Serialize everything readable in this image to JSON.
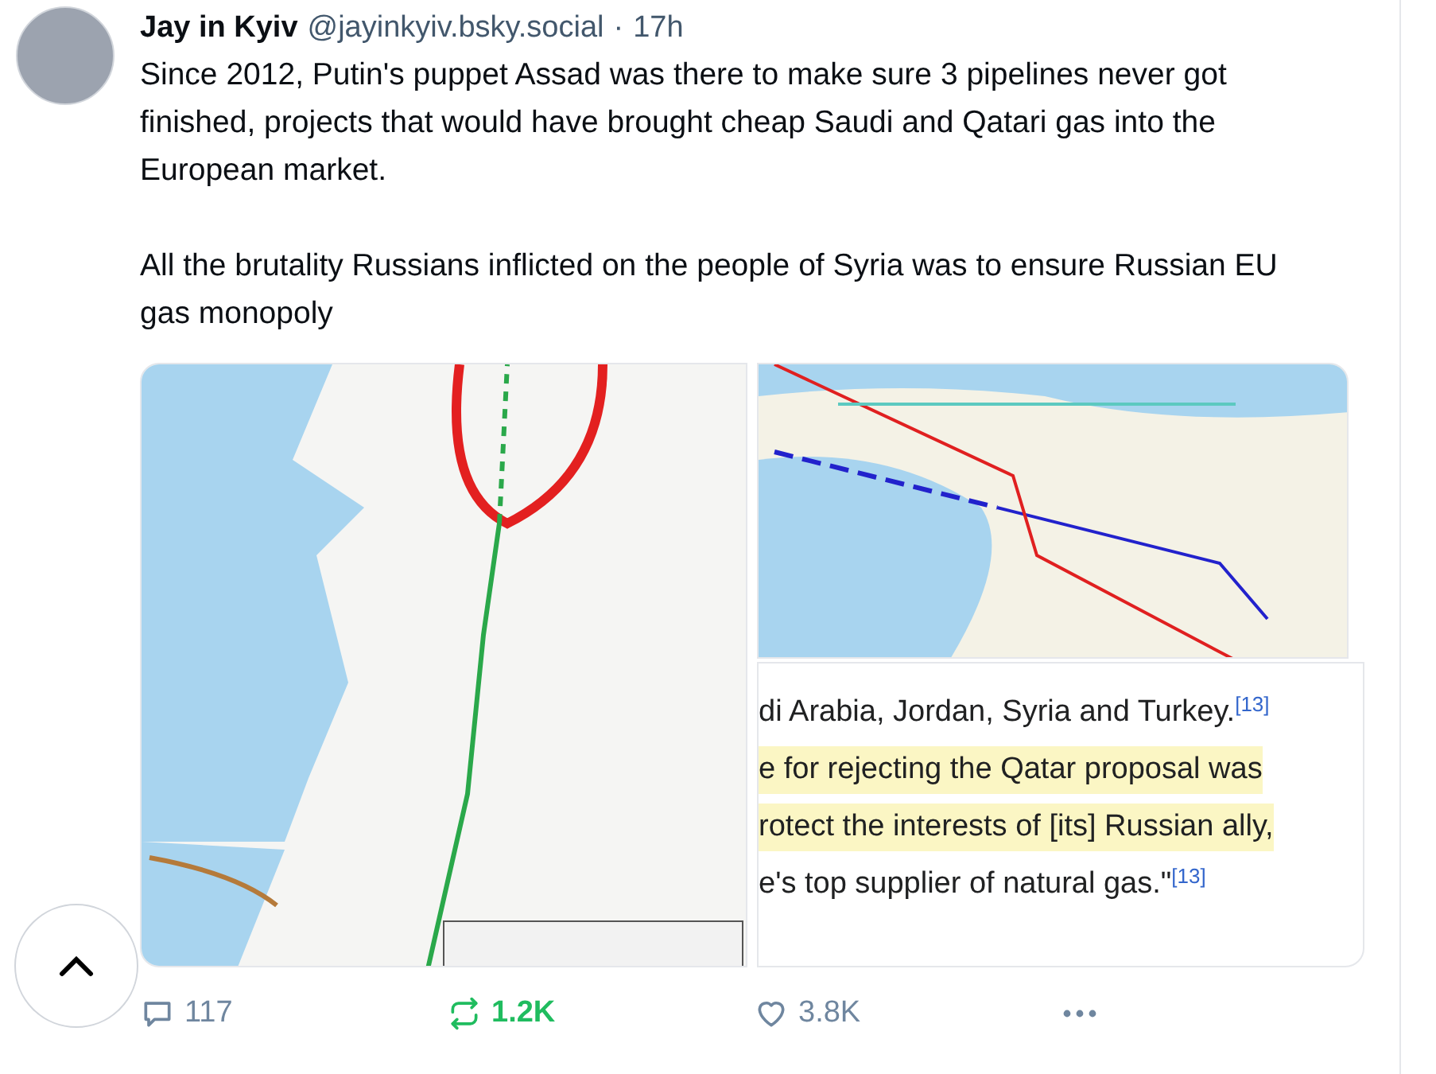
{
  "post": {
    "author": "Jay in Kyiv",
    "handle": "@jayinkyiv.bsky.social",
    "separator": "·",
    "time": "17h",
    "paragraphs": [
      "Since 2012, Putin's puppet Assad was there to make sure 3 pipelines never got finished, projects that would have brought cheap Saudi and Qatari gas into the European market.",
      "All the brutality Russians inflicted on the people of Syria was to ensure Russian EU gas monopoly"
    ]
  },
  "excerpt": {
    "lines": [
      {
        "text": "di Arabia, Jordan, Syria and Turkey.$^{[13]}$",
        "highlighted": false
      },
      {
        "text": "e for rejecting the Qatar proposal was",
        "highlighted": true
      },
      {
        "text": "rotect the interests of [its] Russian ally,",
        "highlighted": true
      },
      {
        "text": "e's top supplier of natural gas.\"$^{[13]}$",
        "highlighted": false
      }
    ]
  },
  "actions": [
    {
      "kind": "reply",
      "count": "117",
      "active": false
    },
    {
      "kind": "repost",
      "count": "1.2K",
      "active": true
    },
    {
      "kind": "like",
      "count": "3.8K",
      "active": false
    },
    {
      "kind": "more",
      "active": false
    }
  ]
}
